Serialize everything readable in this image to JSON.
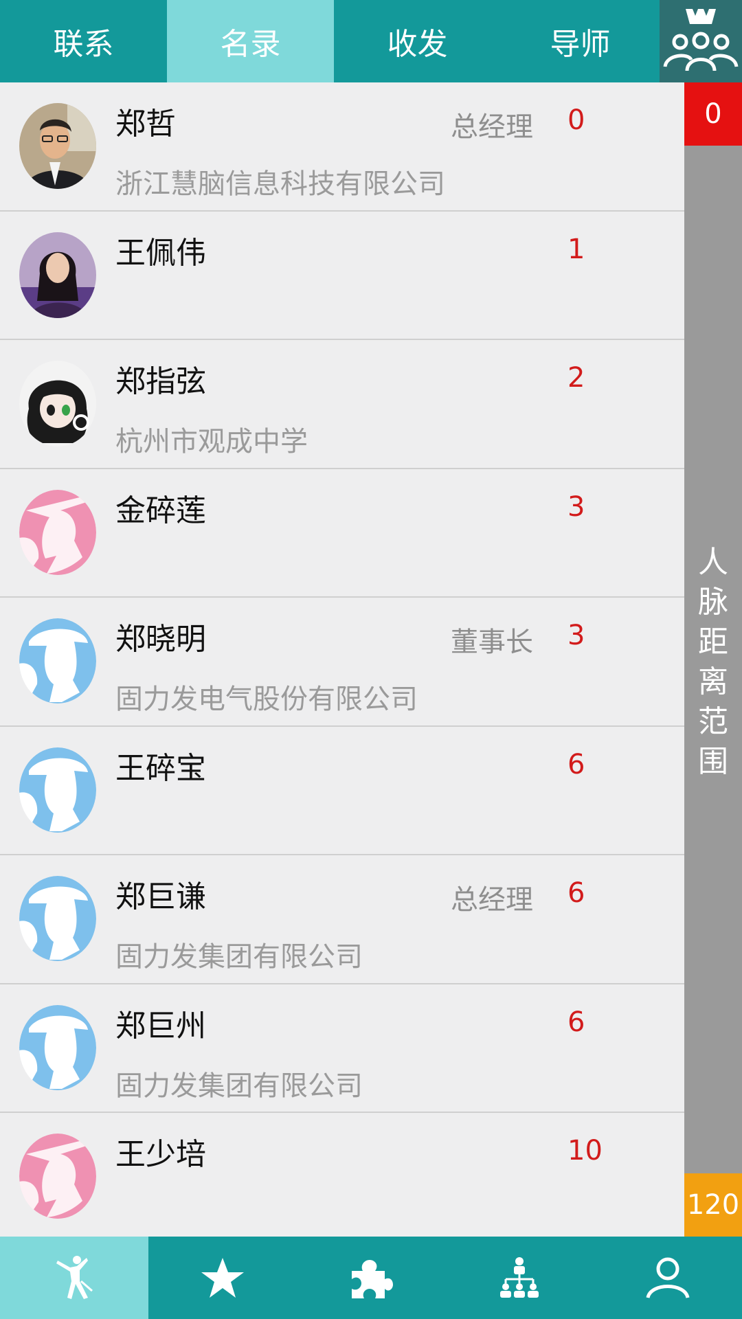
{
  "top_tabs": [
    {
      "label": "联系"
    },
    {
      "label": "名录"
    },
    {
      "label": "收发"
    },
    {
      "label": "导师"
    }
  ],
  "top_group_icon": "group-people-icon",
  "range_bar": {
    "top_value": "0",
    "label": "人\n脉\n距\n离\n范\n围",
    "bottom_value": "120",
    "top_color": "#e51111",
    "bottom_color": "#f2a011"
  },
  "contacts": [
    {
      "name": "郑哲",
      "title": "总经理",
      "count": "0",
      "company": "浙江慧脑信息科技有限公司",
      "avatar": "photo-man-icon"
    },
    {
      "name": "王佩伟",
      "title": "",
      "count": "1",
      "company": "",
      "avatar": "photo-woman-icon"
    },
    {
      "name": "郑指弦",
      "title": "",
      "count": "2",
      "company": "杭州市观成中学",
      "avatar": "anime-avatar-icon"
    },
    {
      "name": "金碎莲",
      "title": "",
      "count": "3",
      "company": "",
      "avatar": "female-default-avatar-icon"
    },
    {
      "name": "郑晓明",
      "title": "董事长",
      "count": "3",
      "company": "固力发电气股份有限公司",
      "avatar": "male-default-avatar-icon"
    },
    {
      "name": "王碎宝",
      "title": "",
      "count": "6",
      "company": "",
      "avatar": "male-default-avatar-icon"
    },
    {
      "name": "郑巨谦",
      "title": "总经理",
      "count": "6",
      "company": "固力发集团有限公司",
      "avatar": "male-default-avatar-icon"
    },
    {
      "name": "郑巨州",
      "title": "",
      "count": "6",
      "company": "固力发集团有限公司",
      "avatar": "male-default-avatar-icon"
    },
    {
      "name": "王少培",
      "title": "",
      "count": "10",
      "company": "",
      "avatar": "female-default-avatar-icon"
    }
  ],
  "bottom_nav": [
    {
      "icon": "dancer-icon",
      "active": true
    },
    {
      "icon": "star-icon",
      "active": false
    },
    {
      "icon": "puzzle-icon",
      "active": false
    },
    {
      "icon": "org-chart-icon",
      "active": false
    },
    {
      "icon": "person-icon",
      "active": false
    }
  ],
  "colors": {
    "primary": "#13999a",
    "active_tab": "#7fd9da",
    "count_red": "#d21b1b"
  }
}
